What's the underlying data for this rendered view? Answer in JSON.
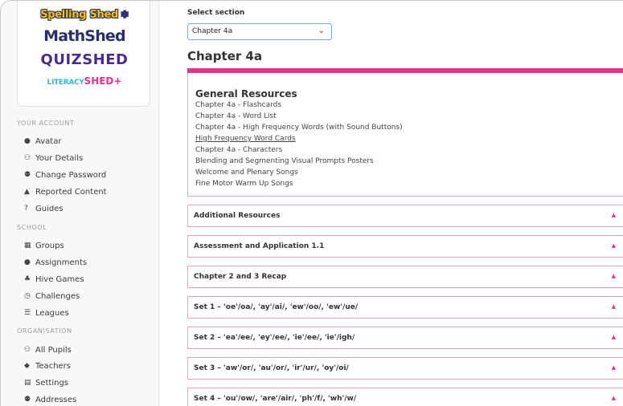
{
  "sidebar": {
    "logos": {
      "spelling": "Spelling Shed",
      "math": "MathShed",
      "quiz": "QUIZSHED",
      "literacy_small": "LITERACY",
      "literacy_big": "SHED",
      "literacy_plus": "+"
    },
    "sections": [
      {
        "title": "YOUR ACCOUNT",
        "items": [
          {
            "label": "Avatar",
            "icon": "user-circle-icon",
            "glyph": "●"
          },
          {
            "label": "Your Details",
            "icon": "user-edit-icon",
            "glyph": "⚇"
          },
          {
            "label": "Change Password",
            "icon": "users-lock-icon",
            "glyph": "⚉"
          },
          {
            "label": "Reported Content",
            "icon": "warning-icon",
            "glyph": "▲"
          },
          {
            "label": "Guides",
            "icon": "question-icon",
            "glyph": "?"
          }
        ]
      },
      {
        "title": "SCHOOL",
        "items": [
          {
            "label": "Groups",
            "icon": "grid-icon",
            "glyph": "▦"
          },
          {
            "label": "Assignments",
            "icon": "assignment-icon",
            "glyph": "●"
          },
          {
            "label": "Hive Games",
            "icon": "sitemap-icon",
            "glyph": "♣"
          },
          {
            "label": "Challenges",
            "icon": "clock-icon",
            "glyph": "◷"
          },
          {
            "label": "Leagues",
            "icon": "list-icon",
            "glyph": "☰"
          }
        ]
      },
      {
        "title": "ORGANISATION",
        "items": [
          {
            "label": "All Pupils",
            "icon": "users-icon",
            "glyph": "⚇"
          },
          {
            "label": "Teachers",
            "icon": "graduation-cap-icon",
            "glyph": "◆"
          },
          {
            "label": "Settings",
            "icon": "settings-icon",
            "glyph": "▤"
          },
          {
            "label": "Addresses",
            "icon": "address-icon",
            "glyph": "⚉"
          }
        ]
      }
    ]
  },
  "main": {
    "select_label": "Select section",
    "select_value": "Chapter 4a",
    "chapter_title": "Chapter 4a",
    "general": {
      "title": "General Resources",
      "links": [
        "Chapter 4a - Flashcards",
        "Chapter 4a - Word List",
        "Chapter 4a - High Frequency Words (with Sound Buttons)",
        "High Frequency Word Cards",
        "Chapter 4a - Characters",
        "Blending and Segmenting Visual Prompts Posters",
        "Welcome and Plenary Songs",
        "Fine Motor Warm Up Songs"
      ]
    },
    "accordions": [
      "Additional Resources",
      "Assessment and Application 1.1",
      "Chapter 2 and 3 Recap",
      "Set 1 – 'oe'/oa/, 'ay'/ai/, 'ew'/oo/, 'ew'/ue/",
      "Set 2 – 'ea'/ee/, 'ey'/ee/, 'ie'/ee/, 'ie'/igh/",
      "Set 3 – 'aw'/or/, 'au'/or/, 'ir'/ur/, 'oy'/oi/",
      "Set 4 – 'ou'/ow/, 'are'/air/, 'ph'/f/, 'wh'/w/"
    ]
  },
  "colors": {
    "accent": "#e6338a",
    "select_border": "#7aa7d6"
  }
}
